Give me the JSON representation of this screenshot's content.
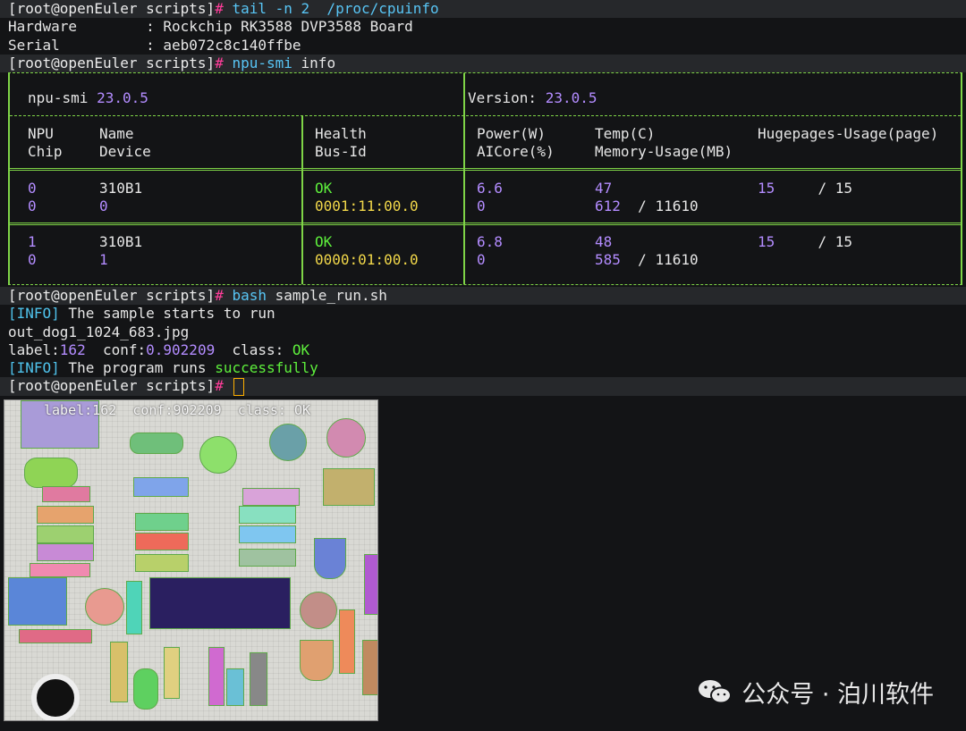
{
  "prompt": {
    "user_host": "[root@openEuler scripts]",
    "hash": "#"
  },
  "lines": {
    "cmd1": "tail -n 2  /proc/cpuinfo",
    "hw_key": "Hardware        ",
    "hw_val": ": Rockchip RK3588 DVP3588 Board",
    "serial_key": "Serial          ",
    "serial_val": ": aeb072c8c140ffbe",
    "cmd2_a": "npu-smi",
    "cmd2_b": " info",
    "cmd3_a": "bash",
    "cmd3_b": " sample_run.sh",
    "info_tag": "[INFO]",
    "info1": " The sample starts to run",
    "out_file": "out_dog1_1024_683.jpg",
    "label_key": "label:",
    "label_val": "162",
    "conf_key": "  conf:",
    "conf_val": "0.902209",
    "class_key": "  class:",
    "class_val": " OK",
    "info2": " The program runs ",
    "info2_ok": "successfully"
  },
  "npu": {
    "tool": "npu-smi",
    "tool_ver": "23.0.5",
    "version_label": "Version:",
    "version": "23.0.5",
    "headers": {
      "npu": "NPU",
      "chip": "Chip",
      "name": "Name",
      "device": "Device",
      "health": "Health",
      "busid": "Bus-Id",
      "power": "Power(W)",
      "aicore": "AICore(%)",
      "temp": "Temp(C)",
      "memory": "Memory-Usage(MB)",
      "huge": "Hugepages-Usage(page)"
    },
    "rows": [
      {
        "npu": "0",
        "name": "310B1",
        "health": "OK",
        "power": "6.6",
        "temp": "47",
        "huge_used": "15",
        "huge_total": "/ 15",
        "chip": "0",
        "device": "0",
        "busid": "0001:11:00.0",
        "aicore": "0",
        "mem_used": "612",
        "mem_total": "/ 11610"
      },
      {
        "npu": "1",
        "name": "310B1",
        "health": "OK",
        "power": "6.8",
        "temp": "48",
        "huge_used": "15",
        "huge_total": "/ 15",
        "chip": "0",
        "device": "1",
        "busid": "0000:01:00.0",
        "aicore": "0",
        "mem_used": "585",
        "mem_total": "/ 11610"
      }
    ]
  },
  "image": {
    "caption": "label:162  conf:902209  class: OK"
  },
  "watermark": {
    "text": "公众号 · 泊川软件"
  }
}
